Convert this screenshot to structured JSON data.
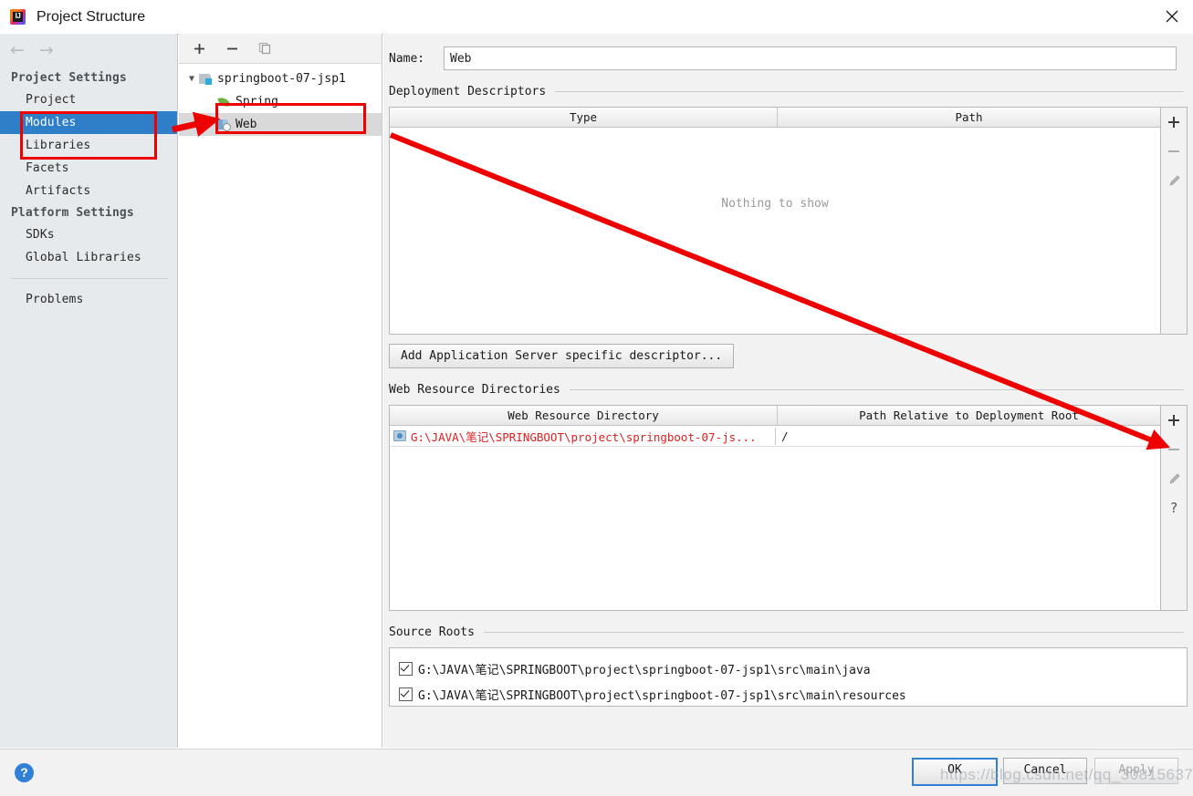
{
  "window": {
    "title": "Project Structure",
    "app_icon": "intellij-idea-icon",
    "close_label": "✕"
  },
  "sidebar": {
    "nav": {
      "back": "←",
      "forward": "→"
    },
    "groups": [
      {
        "label": "Project Settings",
        "items": [
          {
            "label": "Project",
            "selected": false
          },
          {
            "label": "Modules",
            "selected": true
          },
          {
            "label": "Libraries",
            "selected": false
          },
          {
            "label": "Facets",
            "selected": false
          },
          {
            "label": "Artifacts",
            "selected": false
          }
        ]
      },
      {
        "label": "Platform Settings",
        "items": [
          {
            "label": "SDKs",
            "selected": false
          },
          {
            "label": "Global Libraries",
            "selected": false
          }
        ]
      }
    ],
    "problems_label": "Problems"
  },
  "tree_panel": {
    "toolbar": [
      {
        "name": "add-module-button",
        "glyph": "+"
      },
      {
        "name": "remove-module-button",
        "glyph": "−"
      },
      {
        "name": "copy-module-button",
        "glyph": "copy-icon"
      }
    ],
    "nodes": [
      {
        "label": "springboot-07-jsp1",
        "icon": "module-icon",
        "level": 0,
        "expanded": true,
        "selected": false
      },
      {
        "label": "Spring",
        "icon": "spring-leaf-icon",
        "level": 1,
        "selected": false
      },
      {
        "label": "Web",
        "icon": "web-facet-icon",
        "level": 1,
        "selected": true
      }
    ]
  },
  "content": {
    "name_label": "Name:",
    "name_value": "Web",
    "deployment_descriptors": {
      "title": "Deployment Descriptors",
      "columns": [
        "Type",
        "Path"
      ],
      "rows": [],
      "empty_message": "Nothing to show",
      "tools": [
        {
          "name": "dd-add-button",
          "glyph": "+"
        },
        {
          "name": "dd-remove-button",
          "glyph": "−"
        },
        {
          "name": "dd-edit-button",
          "glyph": "pencil-icon"
        }
      ],
      "add_descriptor_button": "Add Application Server specific descriptor..."
    },
    "web_resource_directories": {
      "title": "Web Resource Directories",
      "columns": [
        "Web Resource Directory",
        "Path Relative to Deployment Root"
      ],
      "rows": [
        {
          "directory": "G:\\JAVA\\笔记\\SPRINGBOOT\\project\\springboot-07-js...",
          "path": "/",
          "directory_is_error": true
        }
      ],
      "tools": [
        {
          "name": "wrd-add-button",
          "glyph": "+"
        },
        {
          "name": "wrd-remove-button",
          "glyph": "−"
        },
        {
          "name": "wrd-edit-button",
          "glyph": "pencil-icon"
        },
        {
          "name": "wrd-help-button",
          "glyph": "?"
        }
      ]
    },
    "source_roots": {
      "title": "Source Roots",
      "rows": [
        {
          "path": "G:\\JAVA\\笔记\\SPRINGBOOT\\project\\springboot-07-jsp1\\src\\main\\java",
          "checked": true
        },
        {
          "path": "G:\\JAVA\\笔记\\SPRINGBOOT\\project\\springboot-07-jsp1\\src\\main\\resources",
          "checked": true
        }
      ]
    }
  },
  "footer": {
    "help_glyph": "?",
    "ok_label": "OK",
    "cancel_label": "Cancel",
    "apply_label": "Apply"
  },
  "annotations": {
    "color": "#ee0000",
    "watermark": "https://blog.csdn.net/qq_30815637"
  }
}
